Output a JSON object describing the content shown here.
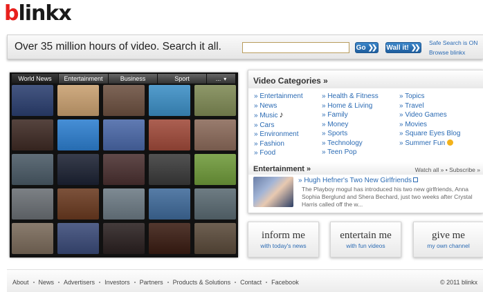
{
  "logo": {
    "text_b": "b",
    "text_rest": "linkx"
  },
  "search": {
    "tagline": "Over 35 million hours of video. Search it all.",
    "value": "",
    "go_label": "Go",
    "wall_label": "Wall it!",
    "safe_search": "Safe Search is ON",
    "browse": "Browse blinkx"
  },
  "wall": {
    "tabs": [
      "World News",
      "Entertainment",
      "Business",
      "Sport",
      "..."
    ],
    "thumb_colors": [
      "#2b3f70",
      "#c9a070",
      "#6c5040",
      "#3c8fc6",
      "#7f8a55",
      "#3e2a24",
      "#2d7fd0",
      "#4a68a8",
      "#a04a3a",
      "#8b6a5a",
      "#4a5a66",
      "#1c2233",
      "#4a3030",
      "#3a3a3a",
      "#6f9a3a",
      "#6a6f74",
      "#6a3a20",
      "#6c7a84",
      "#3f6a9a",
      "#5a6a72",
      "#7a6a5a",
      "#3a4a78",
      "#2a2020",
      "#3a1c12",
      "#5a4a3a"
    ]
  },
  "categories": {
    "title": "Video Categories »",
    "col1": [
      "» Entertainment",
      "» News",
      "» Music",
      "» Cars",
      "» Environment",
      "» Fashion",
      "» Food"
    ],
    "col2": [
      "» Health & Fitness",
      "» Home & Living",
      "» Family",
      "» Money",
      "» Sports",
      "» Technology",
      "» Teen Pop"
    ],
    "col3": [
      "» Topics",
      "» Travel",
      "» Video Games",
      "» Movies",
      "» Square Eyes Blog",
      "» Summer Fun"
    ]
  },
  "entertainment": {
    "title": "Entertainment »",
    "watch_all": "Watch all »",
    "subscribe": "Subscribe »",
    "story_title": "» Hugh Hefner's Two New Girlfriends",
    "story_desc": "The Playboy mogul has introduced his two new girlfriends, Anna Sophia Berglund and Shera Bechard, just two weeks after Crystal Harris called off the w..."
  },
  "promos": [
    {
      "main": "inform me",
      "sub": "with today's news"
    },
    {
      "main": "entertain me",
      "sub": "with fun videos"
    },
    {
      "main": "give me",
      "sub": "my own channel"
    }
  ],
  "footer": {
    "links": [
      "About",
      "News",
      "Advertisers",
      "Investors",
      "Partners",
      "Products & Solutions",
      "Contact",
      "Facebook"
    ],
    "copyright": "© 2011 blinkx"
  }
}
